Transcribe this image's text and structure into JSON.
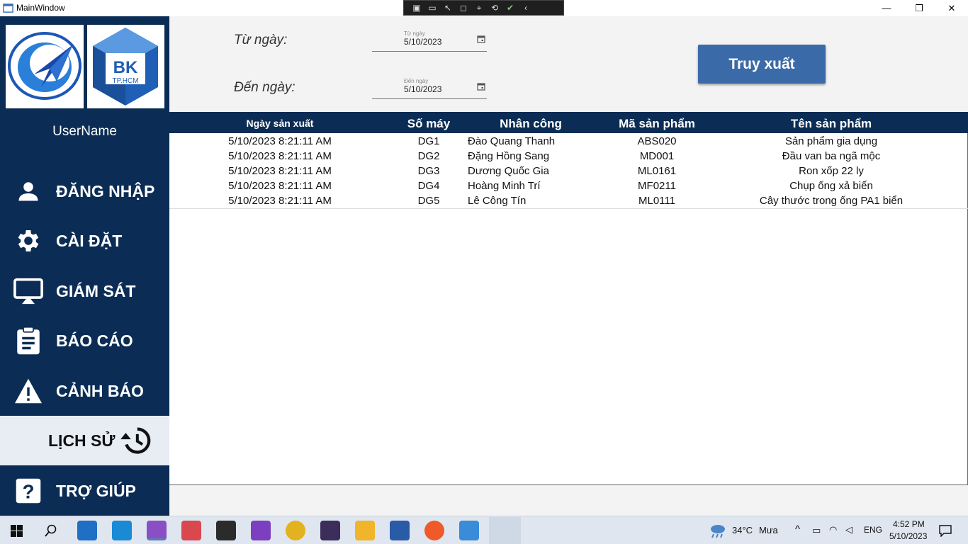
{
  "window": {
    "title": "MainWindow",
    "minimize": "—",
    "maximize": "❐",
    "close": "✕"
  },
  "sidebar": {
    "logo_text": "BK",
    "logo_sub": "TP.HCM",
    "username": "UserName",
    "items": [
      {
        "label": "ĐĂNG NHẬP",
        "icon": "user-icon"
      },
      {
        "label": "CÀI ĐẶT",
        "icon": "gear-icon"
      },
      {
        "label": "GIÁM SÁT",
        "icon": "monitor-icon"
      },
      {
        "label": "BÁO CÁO",
        "icon": "clipboard-icon"
      },
      {
        "label": "CẢNH BÁO",
        "icon": "warning-icon"
      },
      {
        "label": "LỊCH SỬ",
        "icon": "history-icon"
      },
      {
        "label": "TRỢ GIÚP",
        "icon": "help-icon"
      }
    ],
    "active_index": 5
  },
  "filter": {
    "from_label": "Từ ngày:",
    "from_hint": "Từ ngày",
    "from_value": "5/10/2023",
    "to_label": "Đến ngày:",
    "to_hint": "Đến ngày",
    "to_value": "5/10/2023",
    "query_button": "Truy xuất"
  },
  "table": {
    "columns": [
      "Ngày sản xuất",
      "Số máy",
      "Nhân công",
      "Mã sản phẩm",
      "Tên sản phẩm"
    ],
    "rows": [
      [
        "5/10/2023 8:21:11 AM",
        "DG1",
        "Đào Quang Thanh",
        "ABS020",
        "Sản phẩm gia dụng"
      ],
      [
        "5/10/2023 8:21:11 AM",
        "DG2",
        "Đặng Hồng Sang",
        "MD001",
        "Đầu van ba ngã mộc"
      ],
      [
        "5/10/2023 8:21:11 AM",
        "DG3",
        "Dương Quốc Gia",
        "ML0161",
        "Ron xốp 22 ly"
      ],
      [
        "5/10/2023 8:21:11 AM",
        "DG4",
        "Hoàng Minh Trí",
        "MF0211",
        "Chụp ống xả biển"
      ],
      [
        "5/10/2023 8:21:11 AM",
        "DG5",
        "Lê Công Tín",
        "ML0111",
        "Cây thước trong ống PA1 biển"
      ]
    ]
  },
  "taskbar": {
    "weather_temp": "34°C",
    "weather_text": "Mưa",
    "language": "ENG",
    "time": "4:52 PM",
    "date": "5/10/2023"
  },
  "colors": {
    "sidebar": "#0b2d55",
    "button": "#3b6aa8",
    "active_item": "#e8edf4"
  }
}
